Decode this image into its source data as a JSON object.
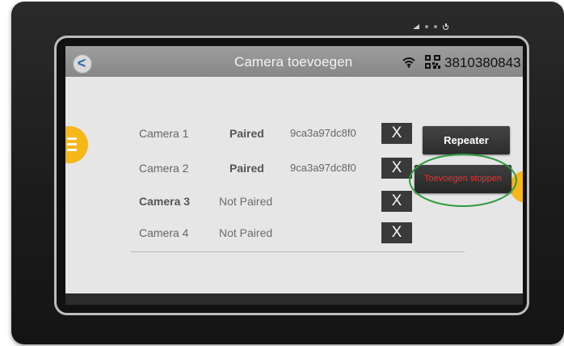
{
  "header": {
    "back_label": "<",
    "title": "Camera toevoegen",
    "device_id": "3810380843"
  },
  "cameras": [
    {
      "name": "Camera 1",
      "status": "Paired",
      "mac": "9ca3a97dc8f0",
      "remove_label": "X"
    },
    {
      "name": "Camera 2",
      "status": "Paired",
      "mac": "9ca3a97dc8f0",
      "remove_label": "X"
    },
    {
      "name": "Camera 3",
      "status": "Not Paired",
      "mac": "",
      "remove_label": "X"
    },
    {
      "name": "Camera 4",
      "status": "Not Paired",
      "mac": "",
      "remove_label": "X"
    }
  ],
  "actions": {
    "repeater_label": "Repeater",
    "stop_label": "Toevoegen stoppen"
  },
  "colors": {
    "accent": "#f5b71a",
    "stop_text": "#ff2a2a",
    "highlight": "#2d9a3a",
    "topbar": "#8f8f8f"
  },
  "icons": [
    "chevron-left-icon",
    "wifi-icon",
    "qr-code-icon",
    "menu-icon",
    "volume-icon",
    "power-icon"
  ]
}
